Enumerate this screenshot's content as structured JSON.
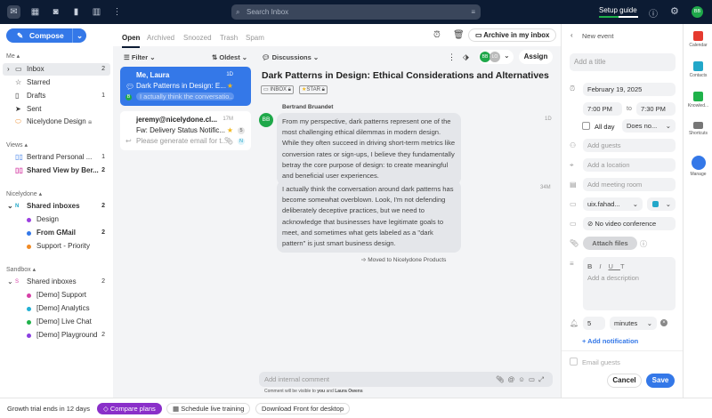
{
  "topbar": {
    "search_placeholder": "Search Inbox",
    "setup_guide": "Setup guide",
    "avatar": "BB",
    "icons": [
      "inbox-icon",
      "calendar-icon",
      "contacts-icon",
      "analytics-icon",
      "columns-icon",
      "more-icon"
    ]
  },
  "sidebar": {
    "compose": "Compose",
    "me_label": "Me",
    "me_items": [
      {
        "label": "Inbox",
        "count": "2"
      },
      {
        "label": "Starred",
        "count": ""
      },
      {
        "label": "Drafts",
        "count": "1"
      },
      {
        "label": "Sent",
        "count": ""
      },
      {
        "label": "Nicelydone Design",
        "count": ""
      }
    ],
    "views_label": "Views",
    "views": [
      {
        "label": "Bertrand Personal ...",
        "count": "1"
      },
      {
        "label": "Shared View by Ber...",
        "count": "2"
      }
    ],
    "nicelydone_label": "Nicelydone",
    "nicelydone_group": {
      "badge": "N",
      "label": "Shared inboxes",
      "count": "2"
    },
    "nicelydone_items": [
      {
        "label": "Design",
        "count": "",
        "color": "#9b3fe0"
      },
      {
        "label": "From GMail",
        "count": "2",
        "color": "#3478e8"
      },
      {
        "label": "Support - Priority",
        "count": "",
        "color": "#f08a24"
      }
    ],
    "sandbox_label": "Sandbox",
    "sandbox_group": {
      "badge": "S",
      "label": "Shared inboxes",
      "count": "2"
    },
    "sandbox_items": [
      {
        "label": "[Demo] Support",
        "count": "",
        "color": "#d63fa6"
      },
      {
        "label": "[Demo] Analytics",
        "count": "",
        "color": "#22b0d4"
      },
      {
        "label": "[Demo] Live Chat",
        "count": "",
        "color": "#1fb24a"
      },
      {
        "label": "[Demo] Playground",
        "count": "2",
        "color": "#8a3fe0"
      }
    ]
  },
  "tabs": [
    "Open",
    "Archived",
    "Snoozed",
    "Trash",
    "Spam"
  ],
  "list": {
    "filter": "Filter",
    "sort": "Oldest",
    "items": [
      {
        "from": "Me, Laura",
        "time": "1D",
        "subject": "Dark Patterns in Design: E...",
        "preview": "I actually think the conversatio...",
        "badge": "B"
      },
      {
        "from": "jeremy@nicelydone.cl...",
        "time": "17M",
        "subject": "Fw: Delivery Status Notific...",
        "preview": "Please generate email for t...",
        "count": "5",
        "badge": "N"
      }
    ]
  },
  "conversation": {
    "view": "Discussions",
    "archive": "Archive in my inbox",
    "assign": "Assign",
    "assignees": [
      "BB",
      "LO"
    ],
    "title": "Dark Patterns in Design: Ethical Considerations and Alternatives",
    "tags": [
      "INBOX",
      "STAR"
    ],
    "sender": "Bertrand Bruandet",
    "sender_initials": "BB",
    "messages": [
      {
        "text": "From my perspective, dark patterns represent one of the most challenging ethical dilemmas in modern design. While they often succeed in driving short-term metrics like conversion rates or sign-ups, I believe they fundamentally betray the core purpose of design: to create meaningful and beneficial user experiences.",
        "time": "1D"
      },
      {
        "text": "I actually think the conversation around dark patterns has become somewhat overblown. Look, I'm not defending deliberately deceptive practices, but we need to acknowledge that businesses have legitimate goals to meet, and sometimes what gets labeled as a \"dark pattern\" is just smart business design.",
        "time": "34M"
      }
    ],
    "event": "Moved to Nicelydone Products",
    "comment_placeholder": "Add internal comment",
    "visibility_prefix": "Comment will be visible to",
    "visibility_you": "you",
    "visibility_and": "and",
    "visibility_name": "Laura Owens"
  },
  "event": {
    "header": "New event",
    "title_placeholder": "Add a title",
    "date": "February 19, 2025",
    "start": "7:00 PM",
    "to": "to",
    "end": "7:30 PM",
    "all_day": "All day",
    "repeat": "Does no...",
    "guests": "Add guests",
    "location": "Add a location",
    "room": "Add meeting room",
    "calendar": "uix.fahad...",
    "video": "No video conference",
    "attach": "Attach files",
    "description": "Add a description",
    "notify_value": "5",
    "notify_unit": "minutes",
    "add_notification": "+ Add notification",
    "email_guests": "Email guests",
    "cancel": "Cancel",
    "save": "Save",
    "calendar_color": "#22a7c9"
  },
  "rail": [
    {
      "label": "Calendar"
    },
    {
      "label": "Contacts"
    },
    {
      "label": "Knowled..."
    },
    {
      "label": "Shortcuts"
    },
    {
      "label": "Manage"
    }
  ],
  "bottom": {
    "trial": "Growth trial ends in 12 days",
    "compare": "Compare plans",
    "training": "Schedule live training",
    "download": "Download Front for desktop"
  }
}
